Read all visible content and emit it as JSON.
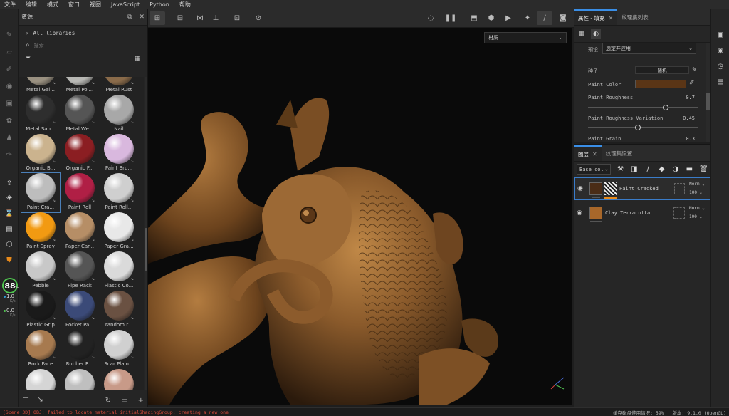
{
  "menu": [
    "文件",
    "编辑",
    "模式",
    "窗口",
    "视图",
    "JavaScript",
    "Python",
    "帮助"
  ],
  "assets": {
    "title": "资源",
    "all_libraries": "All libraries",
    "search_placeholder": "搜索",
    "materials": [
      {
        "label": "Metal Gal...",
        "color": "#9a9181",
        "partial": true
      },
      {
        "label": "Metal Pol...",
        "color": "#b8b8b4",
        "partial": true
      },
      {
        "label": "Metal Rust",
        "color": "#8a6b4a",
        "partial": true
      },
      {
        "label": "Metal San...",
        "color": "#2e2e2e"
      },
      {
        "label": "Metal We...",
        "color": "#555555"
      },
      {
        "label": "Nail",
        "color": "#a8a8a8"
      },
      {
        "label": "Organic B...",
        "color": "#cbb38e"
      },
      {
        "label": "Organic F...",
        "color": "#8b1e22"
      },
      {
        "label": "Paint Bru...",
        "color": "#d9b8de"
      },
      {
        "label": "Paint Cra...",
        "color": "#bdbdbd"
      },
      {
        "label": "Paint Roll",
        "color": "#b01f45"
      },
      {
        "label": "Paint Roll...",
        "color": "#cfcfcf"
      },
      {
        "label": "Paint Spray",
        "color": "#f29a12"
      },
      {
        "label": "Paper Car...",
        "color": "#b68e66"
      },
      {
        "label": "Paper Gra...",
        "color": "#e8e8e8"
      },
      {
        "label": "Pebble",
        "color": "#c8c8c8"
      },
      {
        "label": "Pipe Rack",
        "color": "#555555"
      },
      {
        "label": "Plastic Co...",
        "color": "#dadada"
      },
      {
        "label": "Plastic Grip",
        "color": "#1a1a1a"
      },
      {
        "label": "Pocket Pa...",
        "color": "#3b4a78"
      },
      {
        "label": "random r...",
        "color": "#6a5142"
      },
      {
        "label": "Rock Face",
        "color": "#a77a4f"
      },
      {
        "label": "Rubber R...",
        "color": "#222222"
      },
      {
        "label": "Scar Plain...",
        "color": "#d0d0d0"
      },
      {
        "label": "",
        "color": "#d5d5d5"
      },
      {
        "label": "",
        "color": "#bfbfbf"
      },
      {
        "label": "",
        "color": "#c89a88"
      }
    ]
  },
  "gpu": {
    "value": "88",
    "unit": "%",
    "up": "1.0",
    "down": "0.0",
    "rate_unit": "K/s"
  },
  "viewport": {
    "dropdown": "材质"
  },
  "properties": {
    "tab_label": "属性 - 填充",
    "tab2_label": "纹理集列表",
    "preset_label": "预设",
    "preset_value": "选定并应用",
    "seed_label": "种子",
    "seed_button": "随机",
    "paint_color_label": "Paint Color",
    "paint_color": "#5a3516",
    "rows": [
      {
        "label": "Paint Roughness",
        "value": "0.7",
        "slider": 0.7
      },
      {
        "label": "Paint Roughness Variation",
        "value": "0.45",
        "slider": 0.45
      },
      {
        "label": "Paint Grain",
        "value": "0.3"
      }
    ]
  },
  "layers": {
    "tab_label": "图层",
    "tab2_label": "纹理集设置",
    "channel": "Base col",
    "items": [
      {
        "name": "Paint Cracked",
        "blend": "Norm",
        "opacity": "100",
        "selected": true
      },
      {
        "name": "Clay Terracotta",
        "blend": "Norm",
        "opacity": "100",
        "selected": false
      }
    ]
  },
  "status": {
    "error": "[Scene 3D] OBJ: failed to locate material initialShadingGroup, creating a new one",
    "right": "缓存磁盘使用情况:   59%  |  版本: 9.1.0 (OpenGL)"
  }
}
